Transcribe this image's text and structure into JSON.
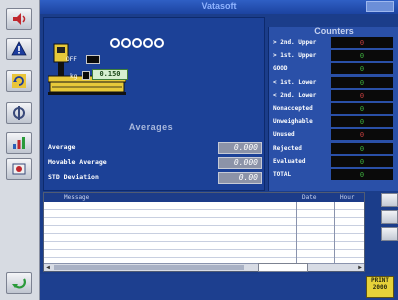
{
  "window": {
    "title": "Vatasoft"
  },
  "scale": {
    "digits": [
      "0",
      "0",
      "0",
      "0",
      "0"
    ],
    "box1_label": "OFF",
    "box2_label": "kg",
    "box2_value": "0.150"
  },
  "averages": {
    "title": "Averages",
    "rows": [
      {
        "label": "Average",
        "value": "0.000"
      },
      {
        "label": "Movable Average",
        "value": "0.000"
      },
      {
        "label": "STD Deviation",
        "value": "0.00"
      }
    ]
  },
  "counters": {
    "title": "Counters",
    "rows": [
      {
        "label": "> 2nd. Upper",
        "value": "0",
        "color": "red"
      },
      {
        "label": "> 1st. Upper",
        "value": "0",
        "color": "green"
      },
      {
        "label": "GOOD",
        "value": "0",
        "color": "green"
      },
      {
        "label": "< 1st. Lower",
        "value": "0",
        "color": "green"
      },
      {
        "label": "< 2nd. Lower",
        "value": "0",
        "color": "red"
      },
      {
        "label": "Nonaccepted",
        "value": "0",
        "color": "green"
      },
      {
        "label": "Unweighable",
        "value": "0",
        "color": "green"
      },
      {
        "label": "Unused",
        "value": "0",
        "color": "red"
      },
      {
        "label": "Rejected",
        "value": "0",
        "color": "green"
      },
      {
        "label": "Evaluated",
        "value": "0",
        "color": "green"
      },
      {
        "label": "TOTAL",
        "value": "0",
        "color": "green"
      }
    ]
  },
  "log": {
    "col_message": "Message",
    "col_date": "Date",
    "col_hour": "Hour"
  },
  "print_button": {
    "line1": "PRINT",
    "line2": "2000"
  },
  "colors": {
    "background": "#1b3d8a",
    "counter_green": "#3fb23f",
    "counter_red": "#c84040",
    "print_yellow": "#e6d23a"
  }
}
